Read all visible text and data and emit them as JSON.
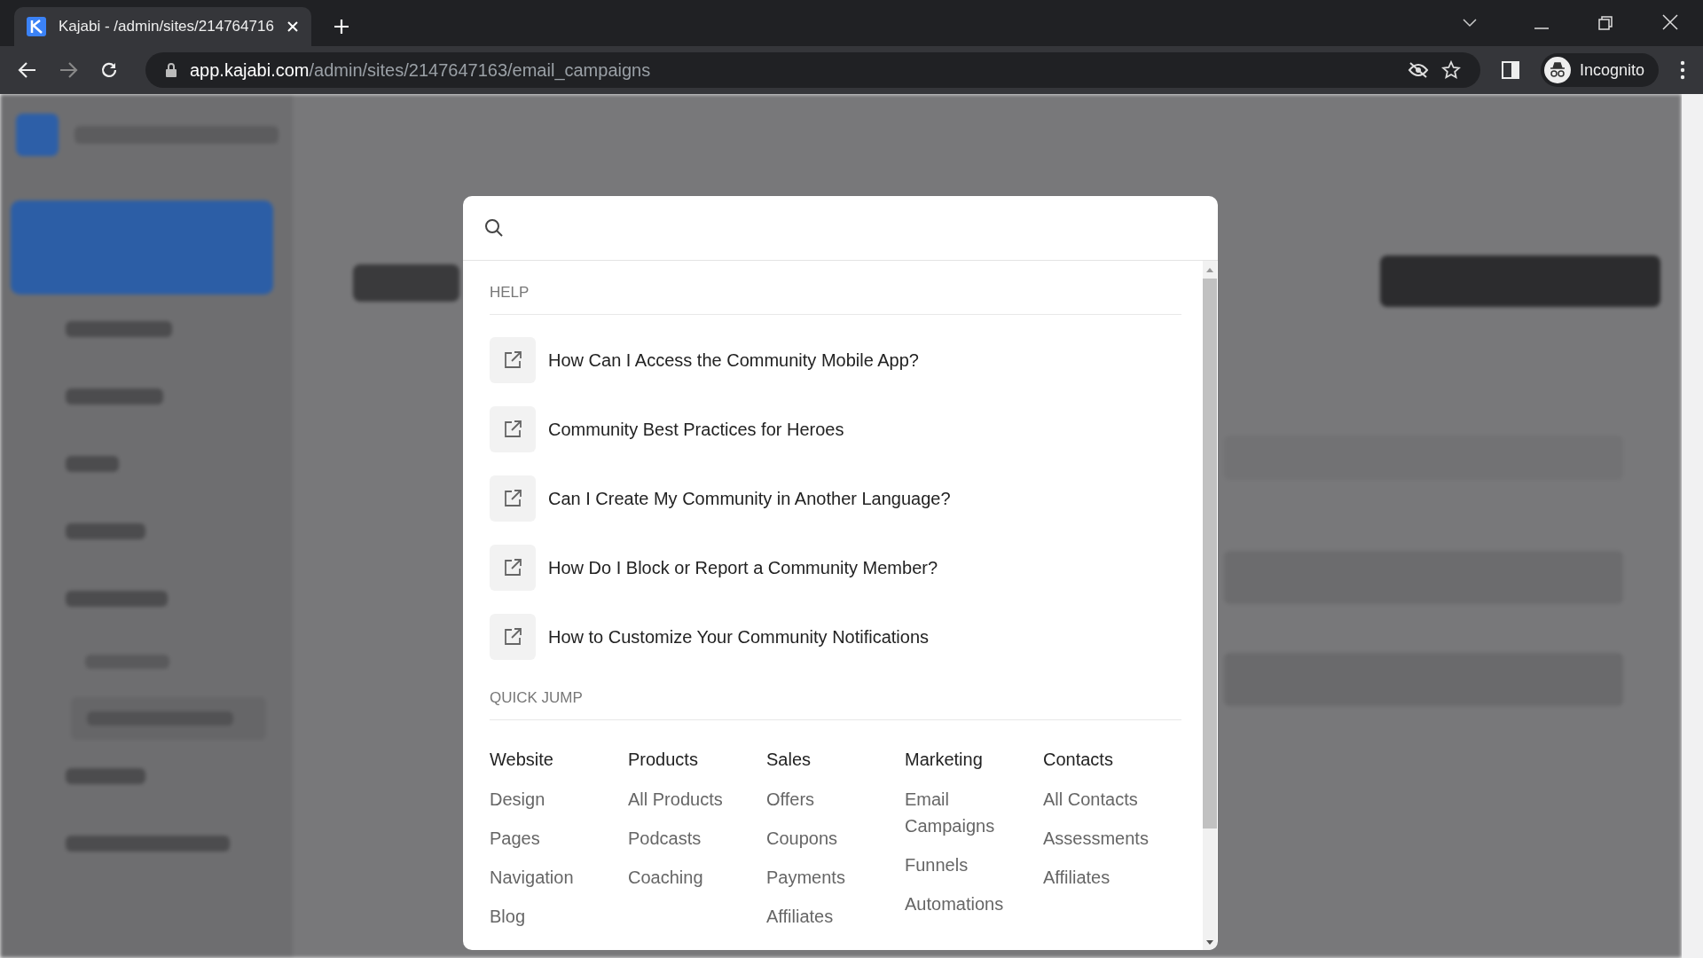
{
  "browser": {
    "tab_title": "Kajabi - /admin/sites/214764716",
    "url_host": "app.kajabi.com",
    "url_path": "/admin/sites/2147647163/email_campaigns",
    "profile": "Incognito"
  },
  "modal": {
    "help_heading": "HELP",
    "help_items": [
      "How Can I Access the Community Mobile App?",
      "Community Best Practices for Heroes",
      "Can I Create My Community in Another Language?",
      "How Do I Block or Report a Community Member?",
      "How to Customize Your Community Notifications"
    ],
    "quick_jump_heading": "QUICK JUMP",
    "columns": [
      {
        "title": "Website",
        "links": [
          "Design",
          "Pages",
          "Navigation",
          "Blog"
        ]
      },
      {
        "title": "Products",
        "links": [
          "All Products",
          "Podcasts",
          "Coaching"
        ]
      },
      {
        "title": "Sales",
        "links": [
          "Offers",
          "Coupons",
          "Payments",
          "Affiliates"
        ]
      },
      {
        "title": "Marketing",
        "links": [
          "Email Campaigns",
          "Funnels",
          "Automations"
        ]
      },
      {
        "title": "Contacts",
        "links": [
          "All Contacts",
          "Assessments",
          "Affiliates"
        ]
      }
    ]
  }
}
